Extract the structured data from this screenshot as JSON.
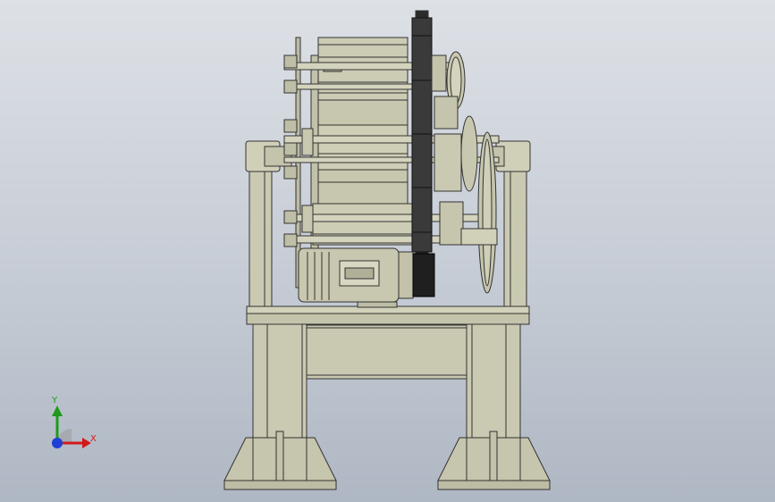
{
  "viewport": {
    "background_top": "#dde1e6",
    "background_bottom": "#aeb7c3",
    "model_color": "#c9c8b0",
    "edge_color": "#333333"
  },
  "triad": {
    "x_label": "X",
    "y_label": "Y",
    "x_color": "#d21a1a",
    "y_color": "#1e9a1e",
    "z_color": "#1f3fd6"
  }
}
